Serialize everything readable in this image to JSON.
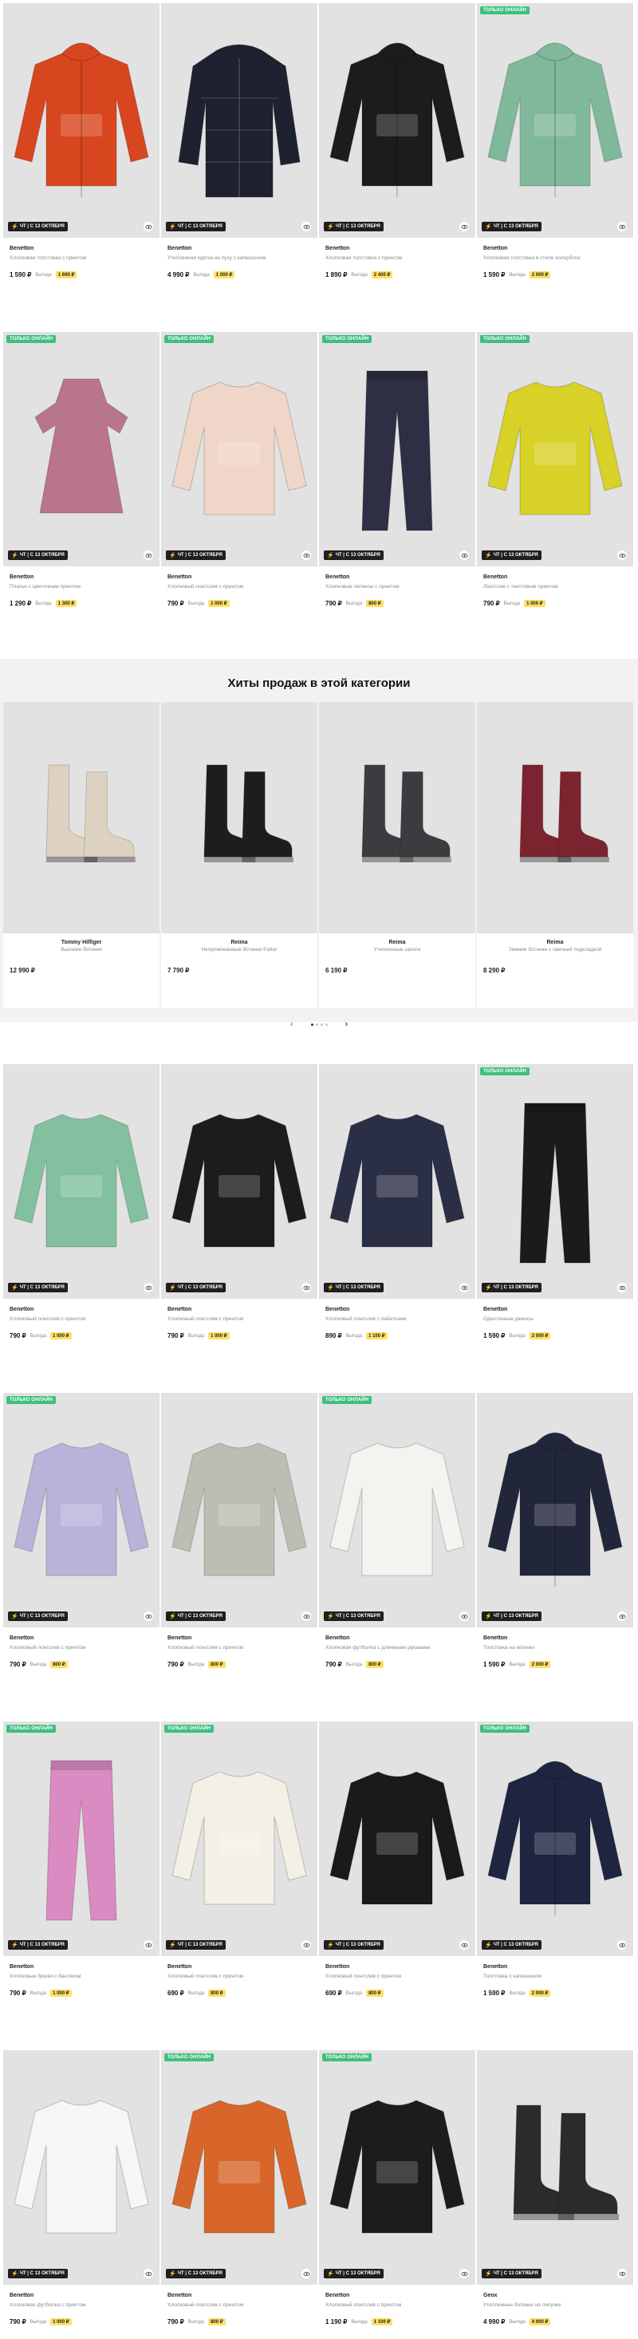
{
  "ui": {
    "online_label": "ТОЛЬКО ОНЛАЙН",
    "sale_label": "ЧТ | С 13 ОКТЯБРЯ",
    "benefit_label": "Выгода"
  },
  "rows": [
    {
      "products": [
        {
          "brand": "Benetton",
          "desc": "Хлопковая толстовка с принтом",
          "price": "1 590 ₽",
          "save": "1 690 ₽",
          "online": false,
          "image": "jacket-orange-hoodie",
          "color": "#d8461f"
        },
        {
          "brand": "Benetton",
          "desc": "Утепленная куртка на пуху с капюшоном",
          "price": "4 990 ₽",
          "save": "1 000 ₽",
          "online": false,
          "image": "puffer-jacket-navy",
          "color": "#1d2130"
        },
        {
          "brand": "Benetton",
          "desc": "Хлопковая толстовка с принтом",
          "price": "1 890 ₽",
          "save": "2 400 ₽",
          "online": false,
          "image": "hoodie-black-print",
          "color": "#1c1c1c"
        },
        {
          "brand": "Benetton",
          "desc": "Хлопковая толстовка в стиле колорблок",
          "price": "1 590 ₽",
          "save": "2 000 ₽",
          "online": true,
          "image": "hoodie-colorblock",
          "color": "#7fb89a"
        }
      ]
    },
    {
      "products": [
        {
          "brand": "Benetton",
          "desc": "Платье с цветочным принтом",
          "price": "1 290 ₽",
          "save": "1 300 ₽",
          "online": true,
          "image": "dress-floral-pink",
          "color": "#b8758d"
        },
        {
          "brand": "Benetton",
          "desc": "Хлопковый лонгслив с принтом",
          "price": "790 ₽",
          "save": "1 000 ₽",
          "online": true,
          "image": "longsleeve-beige",
          "color": "#f0d6c9"
        },
        {
          "brand": "Benetton",
          "desc": "Хлопковые легинсы с принтом",
          "price": "790 ₽",
          "save": "800 ₽",
          "online": true,
          "image": "leggings-floral",
          "color": "#2e2f45"
        },
        {
          "brand": "Benetton",
          "desc": "Лонгслив с текстовым принтом",
          "price": "790 ₽",
          "save": "1 000 ₽",
          "online": true,
          "image": "longsleeve-yellow",
          "color": "#d8d127"
        }
      ]
    }
  ],
  "hits": {
    "title": "Хиты продаж в этой категории",
    "items": [
      {
        "brand": "Tommy Hilfiger",
        "desc": "Высокие ботинки",
        "price": "12 990 ₽",
        "image": "boots-beige",
        "color": "#ddd2c1"
      },
      {
        "brand": "Reima",
        "desc": "Непромокаемые ботинки Patter",
        "price": "7 790 ₽",
        "image": "boots-black-red",
        "color": "#1d1d1d"
      },
      {
        "brand": "Reima",
        "desc": "Утепленные сапоги",
        "price": "6 190 ₽",
        "image": "boots-grey",
        "color": "#3a3c40"
      },
      {
        "brand": "Reima",
        "desc": "Зимние ботинки с овечьей подкладкой",
        "price": "8 290 ₽",
        "image": "boots-burgundy",
        "color": "#7b2430"
      }
    ],
    "prev_label": "‹",
    "next_label": "›"
  },
  "rows2": [
    {
      "products": [
        {
          "brand": "Benetton",
          "desc": "Хлопковый лонгслив с принтом",
          "price": "790 ₽",
          "save": "1 000 ₽",
          "online": false,
          "image": "longsleeve-black-green",
          "color": "#82c0a0"
        },
        {
          "brand": "Benetton",
          "desc": "Хлопковый лонгслив с принтом",
          "price": "790 ₽",
          "save": "1 000 ₽",
          "online": false,
          "image": "longsleeve-black-garage",
          "color": "#1c1c1c"
        },
        {
          "brand": "Benetton",
          "desc": "Хлопковый лонгслив с пайетками",
          "price": "890 ₽",
          "save": "1 100 ₽",
          "online": false,
          "image": "longsleeve-navy",
          "color": "#2b2f45"
        },
        {
          "brand": "Benetton",
          "desc": "Однотонные джинсы",
          "price": "1 590 ₽",
          "save": "2 000 ₽",
          "online": true,
          "image": "jeans-black",
          "color": "#1b1b1b"
        }
      ]
    },
    {
      "products": [
        {
          "brand": "Benetton",
          "desc": "Хлопковый лонгслив с принтом",
          "price": "790 ₽",
          "save": "800 ₽",
          "online": true,
          "image": "longsleeve-lilac-panda",
          "color": "#b8b3d9"
        },
        {
          "brand": "Benetton",
          "desc": "Хлопковый лонгслив с принтом",
          "price": "790 ₽",
          "save": "800 ₽",
          "online": false,
          "image": "longsleeve-grey",
          "color": "#bdbdb4"
        },
        {
          "brand": "Benetton",
          "desc": "Хлопковая футболка с длинными рукавами",
          "price": "790 ₽",
          "save": "800 ₽",
          "online": true,
          "image": "longsleeve-white-print",
          "color": "#f3f3ef"
        },
        {
          "brand": "Benetton",
          "desc": "Толстовка на молнии",
          "price": "1 590 ₽",
          "save": "2 000 ₽",
          "online": false,
          "image": "zip-hoodie-grey",
          "color": "#22263a"
        }
      ]
    },
    {
      "products": [
        {
          "brand": "Benetton",
          "desc": "Хлопковые брюки с бантиком",
          "price": "790 ₽",
          "save": "1 000 ₽",
          "online": true,
          "image": "pants-pink",
          "color": "#d98bc2"
        },
        {
          "brand": "Benetton",
          "desc": "Хлопковый лонгслив с принтом",
          "price": "690 ₽",
          "save": "800 ₽",
          "online": true,
          "image": "longsleeve-cream",
          "color": "#f4f0e6"
        },
        {
          "brand": "Benetton",
          "desc": "Хлопковый лонгслив с принтом",
          "price": "690 ₽",
          "save": "800 ₽",
          "online": false,
          "image": "longsleeve-black-rock",
          "color": "#1a1a1a"
        },
        {
          "brand": "Benetton",
          "desc": "Толстовка с капюшоном",
          "price": "1 590 ₽",
          "save": "2 000 ₽",
          "online": true,
          "image": "hoodie-navy-grey",
          "color": "#1f2440"
        }
      ]
    },
    {
      "products": [
        {
          "brand": "Benetton",
          "desc": "Хлопковая футболка с принтом",
          "price": "790 ₽",
          "save": "1 000 ₽",
          "online": false,
          "image": "longsleeve-white-cars",
          "color": "#f6f6f4"
        },
        {
          "brand": "Benetton",
          "desc": "Хлопковый лонгслив с принтом",
          "price": "790 ₽",
          "save": "800 ₽",
          "online": true,
          "image": "longsleeve-orange",
          "color": "#d8662a"
        },
        {
          "brand": "Benetton",
          "desc": "Хлопковый лонгслив с принтом",
          "price": "1 190 ₽",
          "save": "1 100 ₽",
          "online": true,
          "image": "longsleeve-black-girl",
          "color": "#1c1c1c"
        },
        {
          "brand": "Geox",
          "desc": "Утепленные ботинки на липучке",
          "price": "4 990 ₽",
          "save": "4 000 ₽",
          "online": false,
          "image": "boots-geox-black",
          "color": "#2b2b2b"
        }
      ]
    }
  ]
}
